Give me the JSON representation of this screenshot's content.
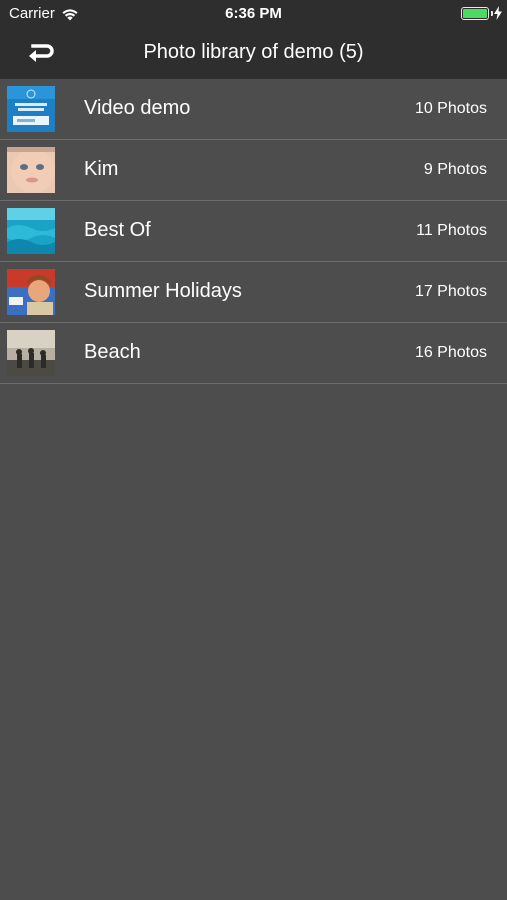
{
  "status_bar": {
    "carrier": "Carrier",
    "time": "6:36 PM",
    "battery_level": 1.0,
    "battery_color": "#4cd964"
  },
  "nav": {
    "back_icon": "return-arrow-icon",
    "title": "Photo library of demo (5)"
  },
  "albums": [
    {
      "name": "Video demo",
      "count": "10 Photos",
      "thumbnail": "video-demo-thumbnail"
    },
    {
      "name": "Kim",
      "count": "9 Photos",
      "thumbnail": "baby-face-thumbnail"
    },
    {
      "name": "Best Of",
      "count": "11 Photos",
      "thumbnail": "ocean-water-thumbnail"
    },
    {
      "name": "Summer Holidays",
      "count": "17 Photos",
      "thumbnail": "child-portrait-thumbnail"
    },
    {
      "name": "Beach",
      "count": "16 Photos",
      "thumbnail": "beach-sunset-thumbnail"
    }
  ],
  "colors": {
    "background": "#4d4d4d",
    "header": "#2e2e2e",
    "separator": "#6e6e6e",
    "text": "#ffffff"
  }
}
